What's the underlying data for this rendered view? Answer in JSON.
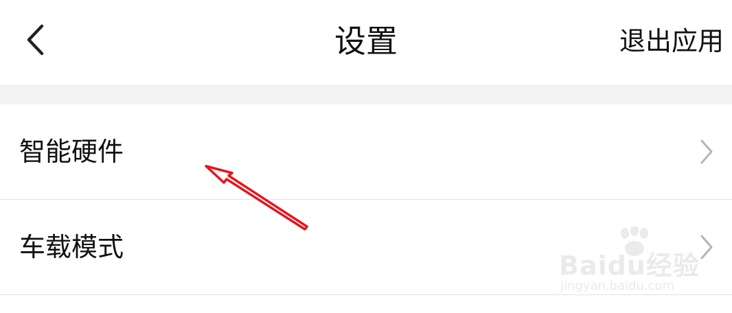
{
  "header": {
    "back_icon": "chevron-left-icon",
    "title": "设置",
    "exit_label": "退出应用"
  },
  "settings": {
    "items": [
      {
        "label": "智能硬件",
        "icon": "chevron-right-icon"
      },
      {
        "label": "车载模式",
        "icon": "chevron-right-icon"
      }
    ]
  },
  "annotation": {
    "color": "#e8141c"
  },
  "watermark": {
    "brand": "Baidu经验",
    "site": "jingyan.baidu.com"
  },
  "colors": {
    "background": "#ffffff",
    "section_gap": "#f2f3f5",
    "text": "#111111",
    "chevron": "#b5b5b5"
  }
}
